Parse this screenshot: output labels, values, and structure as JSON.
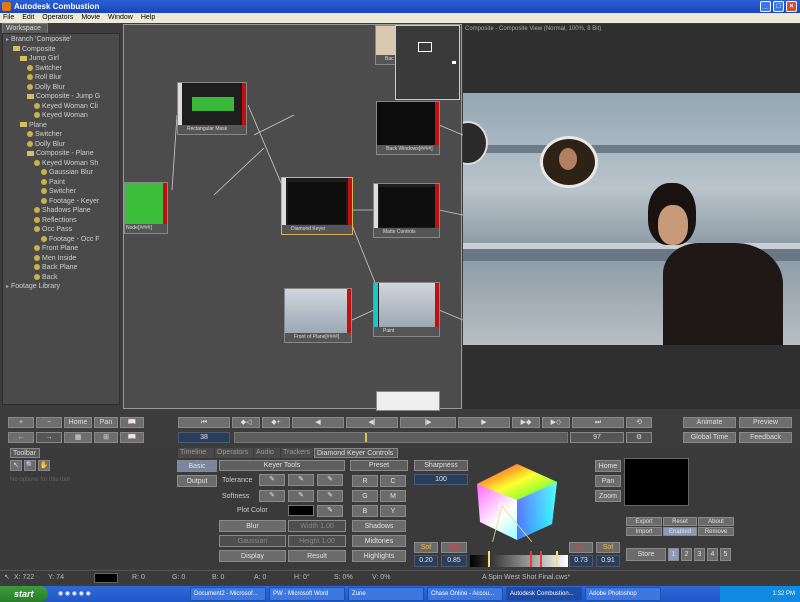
{
  "window": {
    "title": "Autodesk Combustion",
    "controls": [
      "_",
      "□",
      "×"
    ]
  },
  "menu": [
    "File",
    "Edit",
    "Operators",
    "Movie",
    "Window",
    "Help"
  ],
  "workspace": {
    "tab": "Workspace",
    "items": [
      {
        "label": "Branch 'Composite'",
        "depth": 0,
        "kind": "ex"
      },
      {
        "label": "Composite",
        "depth": 1,
        "kind": "fo"
      },
      {
        "label": "Jump Girl",
        "depth": 2,
        "kind": "fo"
      },
      {
        "label": "Switcher",
        "depth": 3,
        "kind": "ic"
      },
      {
        "label": "Roll Blur",
        "depth": 3,
        "kind": "ic"
      },
      {
        "label": "Dolly Blur",
        "depth": 3,
        "kind": "ic"
      },
      {
        "label": "Composite - Jump G",
        "depth": 3,
        "kind": "fo"
      },
      {
        "label": "Keyed Woman Cli",
        "depth": 4,
        "kind": "ic"
      },
      {
        "label": "Keyed Woman",
        "depth": 4,
        "kind": "ic"
      },
      {
        "label": "Plane",
        "depth": 2,
        "kind": "fo"
      },
      {
        "label": "Switcher",
        "depth": 3,
        "kind": "ic"
      },
      {
        "label": "Dolly Blur",
        "depth": 3,
        "kind": "ic"
      },
      {
        "label": "Composite - Plane",
        "depth": 3,
        "kind": "fo"
      },
      {
        "label": "Keyed Woman Sh",
        "depth": 4,
        "kind": "ic"
      },
      {
        "label": "Gaussian Blur",
        "depth": 5,
        "kind": "ic"
      },
      {
        "label": "Paint",
        "depth": 5,
        "kind": "ic"
      },
      {
        "label": "Switcher",
        "depth": 5,
        "kind": "ic"
      },
      {
        "label": "Footage - Keyer",
        "depth": 5,
        "kind": "ic"
      },
      {
        "label": "Shadows Plane",
        "depth": 4,
        "kind": "ic"
      },
      {
        "label": "Reflections",
        "depth": 4,
        "kind": "ic"
      },
      {
        "label": "Occ Pass",
        "depth": 4,
        "kind": "ic"
      },
      {
        "label": "Footage - Occ F",
        "depth": 5,
        "kind": "ic"
      },
      {
        "label": "Front Plane",
        "depth": 4,
        "kind": "ic"
      },
      {
        "label": "Men Inside",
        "depth": 4,
        "kind": "ic"
      },
      {
        "label": "Back Plane",
        "depth": 4,
        "kind": "ic"
      },
      {
        "label": "Back",
        "depth": 4,
        "kind": "ic"
      },
      {
        "label": "Footage Library",
        "depth": 0,
        "kind": "ex"
      }
    ]
  },
  "schematic": {
    "nodes": [
      {
        "id": "rect-mask",
        "label": "Rectangular Mask"
      },
      {
        "id": "back-windows",
        "label": "Back Windows[####]"
      },
      {
        "id": "keyer-left",
        "label": "Node[####]"
      },
      {
        "id": "diamond-keyer",
        "label": "Diamond Keyer"
      },
      {
        "id": "matte-controls",
        "label": "Matte Controls"
      },
      {
        "id": "front-plane",
        "label": "Front of Plane[####]"
      },
      {
        "id": "paint",
        "label": "Paint"
      },
      {
        "id": "top-node",
        "label": "Bac"
      }
    ]
  },
  "viewer": {
    "title": "Composite - Composite View (Normal, 100%, 8 Bit)"
  },
  "transport": {
    "left": {
      "row1": [
        "+",
        "−",
        "Home",
        "Pan"
      ],
      "row2": [
        "←",
        "→"
      ]
    },
    "frame_current": "38",
    "frame_end": "97",
    "right": {
      "animate": "Animate",
      "preview": "Preview",
      "global_time": "Global Time",
      "feedback": "Feedback"
    }
  },
  "tabs": [
    "Toolbar",
    "Timeline",
    "Operators",
    "Audio",
    "Trackers",
    "Diamond Keyer Controls"
  ],
  "toolbar_hint": "No options for this tool",
  "keyer": {
    "side": [
      "Basic",
      "Output"
    ],
    "title": "Keyer Tools",
    "tolerance": "Tolerance",
    "softness": "Softness",
    "plot_color": "Plot Color",
    "blur": "Blur",
    "gaussian": "Gaussian",
    "width": "Width 1.00",
    "height": "Height 1.00",
    "display": "Display",
    "result": "Result",
    "preset": "Preset",
    "preset_btns": [
      "R",
      "C",
      "G",
      "M",
      "B",
      "Y"
    ],
    "shadows": "Shadows",
    "midtones": "Midtones",
    "highlights": "Highlights",
    "sharpness": "Sharpness",
    "sharpness_val": "100",
    "sof_left": [
      "Sof",
      "Sof"
    ],
    "vals_left": [
      "0.20",
      "0.85"
    ],
    "sof_right": [
      "Sof",
      "Sof"
    ],
    "vals_right": [
      "0.73",
      "0.91"
    ],
    "view_btns": [
      "Home",
      "Pan",
      "Zoom"
    ],
    "export": "Export",
    "reset": "Reset",
    "about": "About",
    "import": "Import",
    "enabled": "Enabled",
    "remove": "Remove",
    "store": "Store",
    "store_nums": [
      "1",
      "2",
      "3",
      "4",
      "5"
    ]
  },
  "status": {
    "x": "X: 722",
    "y": "Y: 74",
    "r": "R: 0",
    "g": "G: 0",
    "b": "B: 0",
    "a": "A: 0",
    "h": "H: 0°",
    "s": "S: 0%",
    "v": "V: 0%",
    "file": "A Spin West Shot Final.cws*"
  },
  "taskbar": {
    "start": "start",
    "items": [
      "Document2 - Microsof...",
      "PW - Microsoft Word",
      "Zune",
      "Chase Online - Accou...",
      "Autodesk Combustion...",
      "Adobe Photoshop"
    ],
    "clock": "1:32 PM"
  }
}
